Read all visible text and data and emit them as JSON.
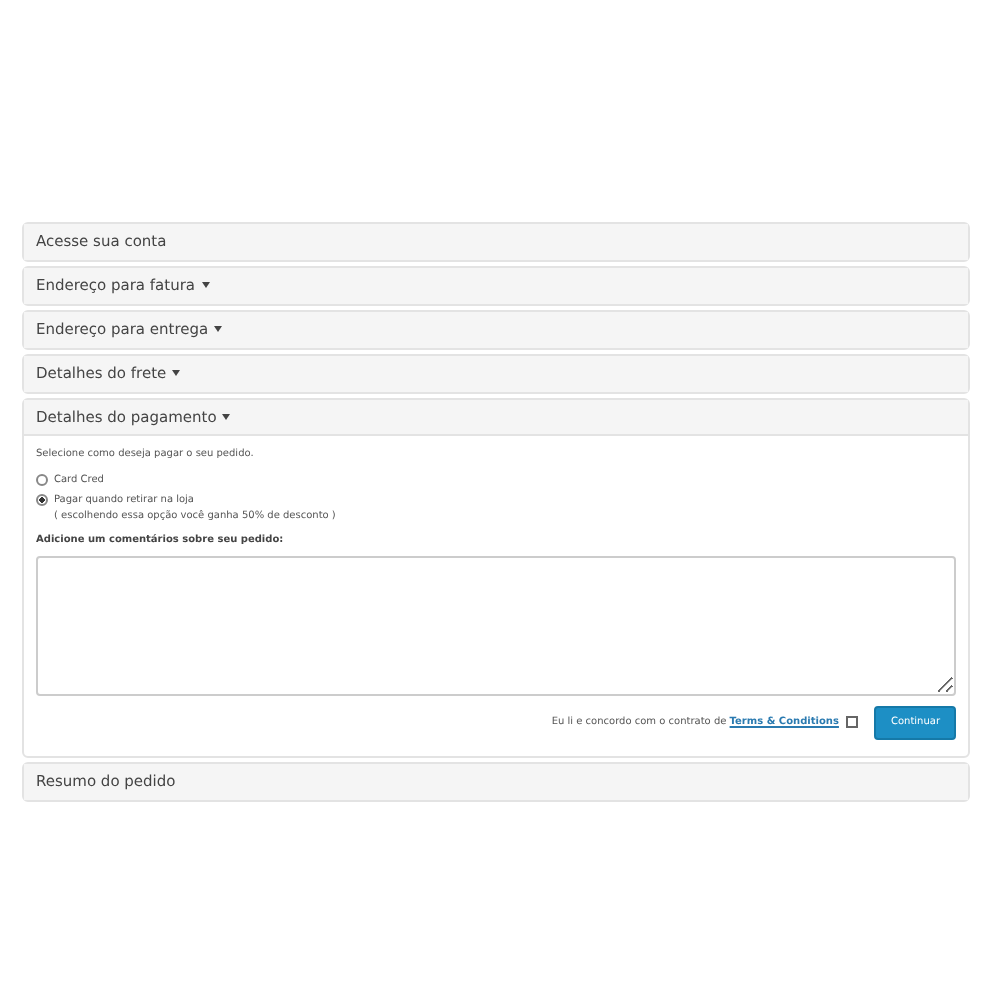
{
  "panels": [
    {
      "title": "Acesse sua conta",
      "caret": false,
      "expanded": false
    },
    {
      "title": "Endereço para fatura",
      "caret": true,
      "expanded": false
    },
    {
      "title": "Endereço para entrega",
      "caret": true,
      "expanded": false
    },
    {
      "title": "Detalhes do frete",
      "caret": true,
      "expanded": false
    },
    {
      "title": "Detalhes do pagamento",
      "caret": true,
      "expanded": true,
      "payment": {
        "intro": "Selecione como deseja pagar o seu pedido.",
        "options": [
          {
            "label": "Card Cred",
            "selected": false
          },
          {
            "label": "Pagar quando retirar na loja",
            "note": "( escolhendo essa opção você ganha 50% de desconto )",
            "selected": true
          }
        ],
        "comment_label": "Adicione um comentários sobre seu pedido:",
        "terms_text": "Eu li e concordo com o contrato de",
        "terms_link": "Terms & Conditions",
        "terms_checked": false,
        "button": "Continuar"
      }
    },
    {
      "title": "Resumo do pedido",
      "caret": false,
      "expanded": false
    }
  ]
}
